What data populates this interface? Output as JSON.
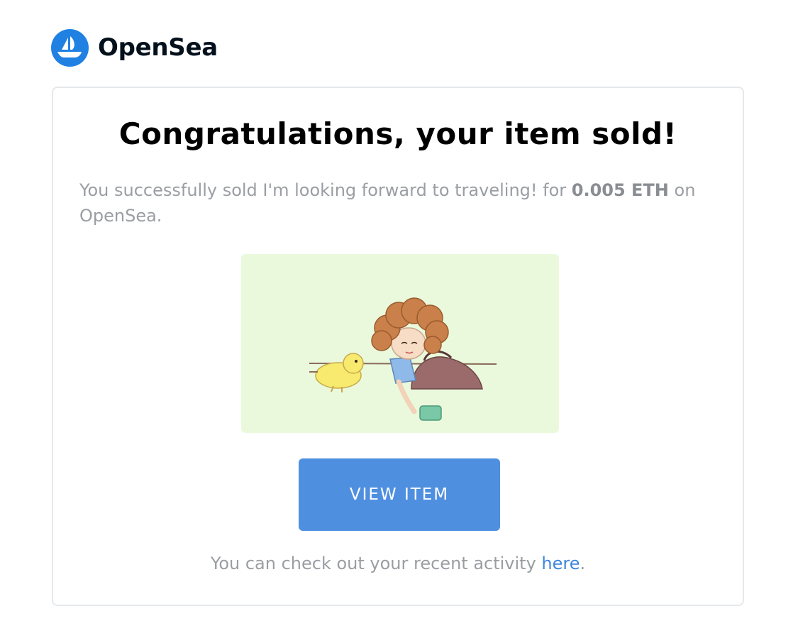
{
  "brand": {
    "name": "OpenSea",
    "logo_icon": "opensea-boat-icon",
    "color": "#2081e2"
  },
  "email": {
    "heading": "Congratulations, your item sold!",
    "message_prefix": "You successfully sold I'm looking forward to traveling! for ",
    "price": "0.005 ETH",
    "message_suffix": " on OpenSea.",
    "artwork_icon": "nft-illustration-girl-with-chick",
    "button_label": "VIEW ITEM",
    "button_color": "#4f8fe0",
    "footer_prefix": "You can check out your recent activity ",
    "footer_link": "here",
    "footer_suffix": ".",
    "link_color": "#3d86dc"
  }
}
